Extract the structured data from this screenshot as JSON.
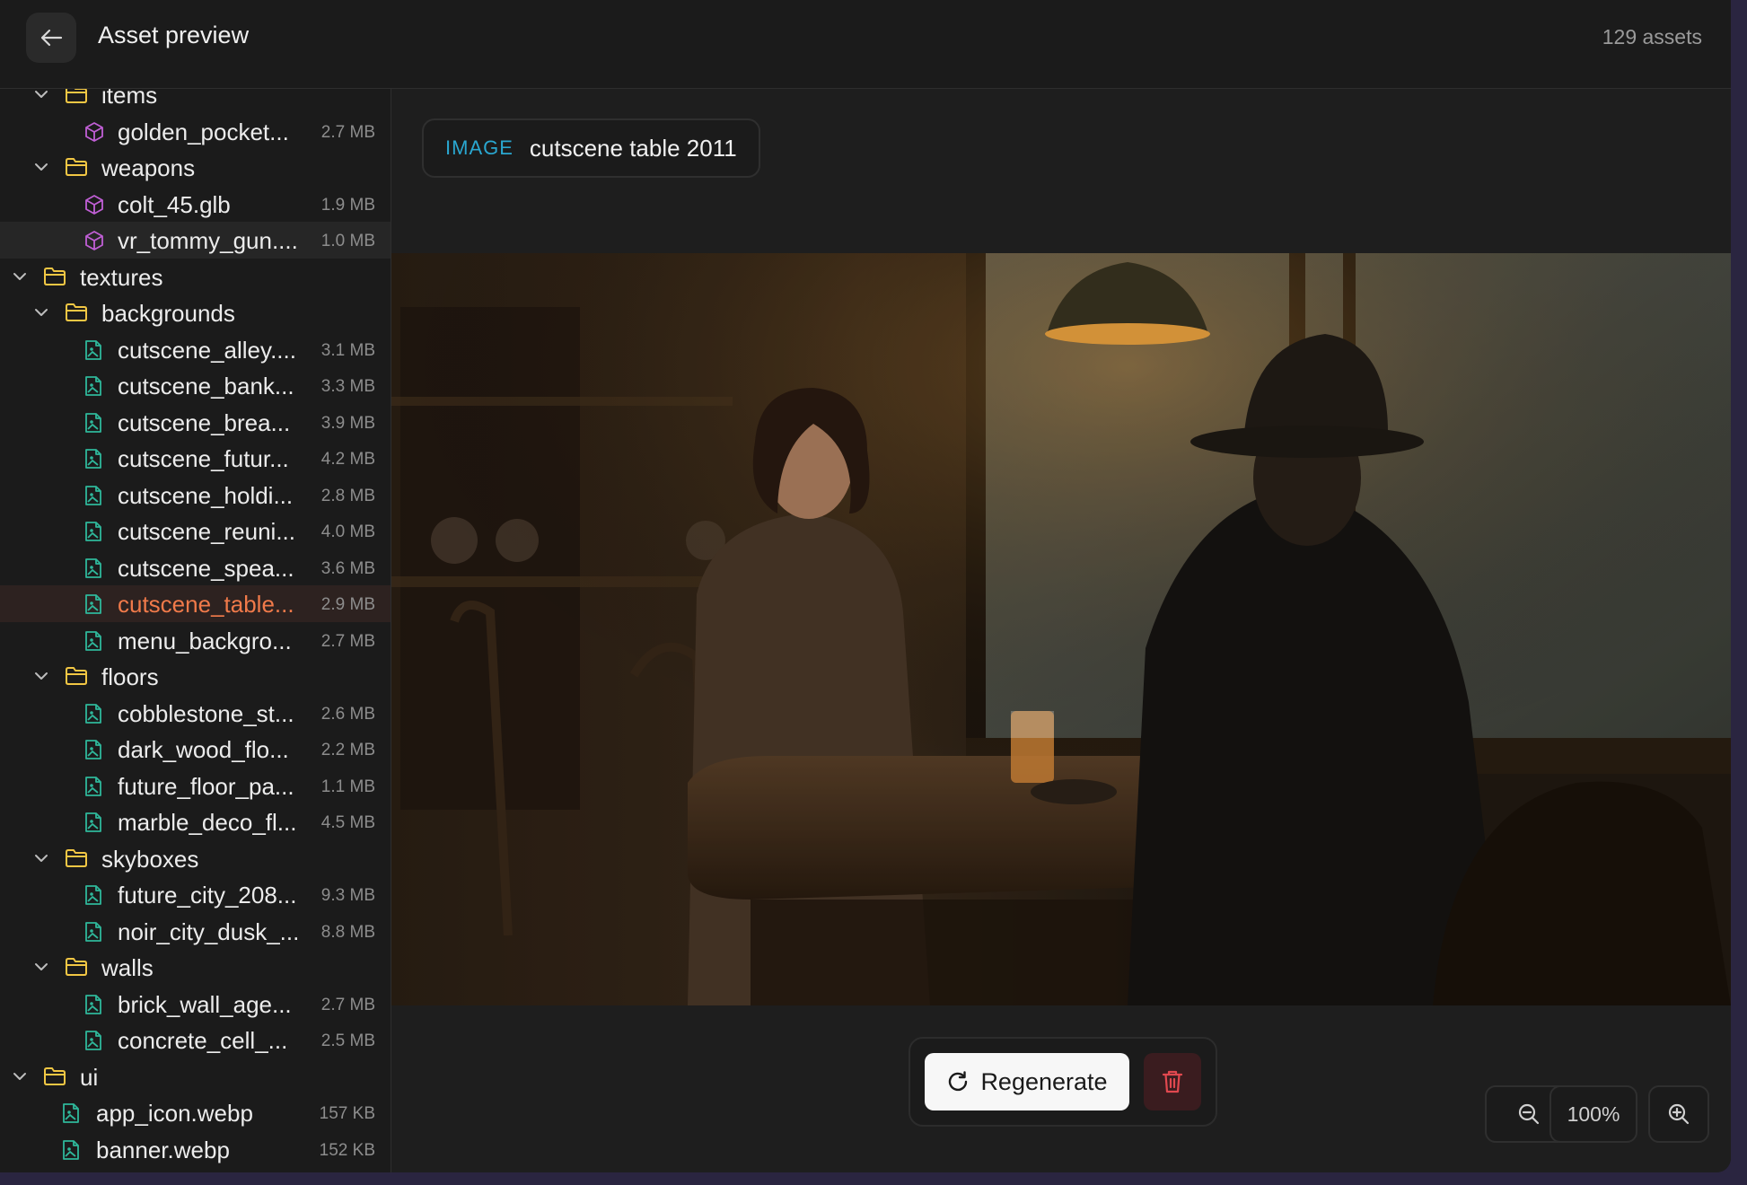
{
  "header": {
    "back_icon": "arrow-left-icon",
    "title": "Asset preview",
    "asset_count": "129 assets"
  },
  "tree": [
    {
      "kind": "folder",
      "level": 1,
      "name": "items"
    },
    {
      "kind": "model",
      "level": 2,
      "name": "golden_pocket...",
      "size": "2.7 MB"
    },
    {
      "kind": "folder",
      "level": 1,
      "name": "weapons"
    },
    {
      "kind": "model",
      "level": 2,
      "name": "colt_45.glb",
      "size": "1.9 MB"
    },
    {
      "kind": "model",
      "level": 2,
      "name": "vr_tommy_gun....",
      "size": "1.0 MB",
      "state": "hover"
    },
    {
      "kind": "folder",
      "level": 0,
      "name": "textures"
    },
    {
      "kind": "folder",
      "level": 1,
      "name": "backgrounds"
    },
    {
      "kind": "image",
      "level": 2,
      "name": "cutscene_alley....",
      "size": "3.1 MB"
    },
    {
      "kind": "image",
      "level": 2,
      "name": "cutscene_bank...",
      "size": "3.3 MB"
    },
    {
      "kind": "image",
      "level": 2,
      "name": "cutscene_brea...",
      "size": "3.9 MB"
    },
    {
      "kind": "image",
      "level": 2,
      "name": "cutscene_futur...",
      "size": "4.2 MB"
    },
    {
      "kind": "image",
      "level": 2,
      "name": "cutscene_holdi...",
      "size": "2.8 MB"
    },
    {
      "kind": "image",
      "level": 2,
      "name": "cutscene_reuni...",
      "size": "4.0 MB"
    },
    {
      "kind": "image",
      "level": 2,
      "name": "cutscene_spea...",
      "size": "3.6 MB"
    },
    {
      "kind": "image",
      "level": 2,
      "name": "cutscene_table...",
      "size": "2.9 MB",
      "state": "selected"
    },
    {
      "kind": "image",
      "level": 2,
      "name": "menu_backgro...",
      "size": "2.7 MB"
    },
    {
      "kind": "folder",
      "level": 1,
      "name": "floors"
    },
    {
      "kind": "image",
      "level": 2,
      "name": "cobblestone_st...",
      "size": "2.6 MB"
    },
    {
      "kind": "image",
      "level": 2,
      "name": "dark_wood_flo...",
      "size": "2.2 MB"
    },
    {
      "kind": "image",
      "level": 2,
      "name": "future_floor_pa...",
      "size": "1.1 MB"
    },
    {
      "kind": "image",
      "level": 2,
      "name": "marble_deco_fl...",
      "size": "4.5 MB"
    },
    {
      "kind": "folder",
      "level": 1,
      "name": "skyboxes"
    },
    {
      "kind": "image",
      "level": 2,
      "name": "future_city_208...",
      "size": "9.3 MB"
    },
    {
      "kind": "image",
      "level": 2,
      "name": "noir_city_dusk_...",
      "size": "8.8 MB"
    },
    {
      "kind": "folder",
      "level": 1,
      "name": "walls"
    },
    {
      "kind": "image",
      "level": 2,
      "name": "brick_wall_age...",
      "size": "2.7 MB"
    },
    {
      "kind": "image",
      "level": 2,
      "name": "concrete_cell_...",
      "size": "2.5 MB"
    },
    {
      "kind": "folder",
      "level": 0,
      "name": "ui"
    },
    {
      "kind": "image",
      "level": 1,
      "name": "app_icon.webp",
      "size": "157 KB"
    },
    {
      "kind": "image",
      "level": 1,
      "name": "banner.webp",
      "size": "152 KB"
    }
  ],
  "preview": {
    "type_label": "IMAGE",
    "asset_name": "cutscene table 2011"
  },
  "actions": {
    "regenerate_label": "Regenerate",
    "regenerate_icon": "refresh-icon",
    "delete_icon": "trash-icon"
  },
  "zoom": {
    "level": "100%",
    "zoom_out_icon": "zoom-out-icon",
    "zoom_in_icon": "zoom-in-icon"
  },
  "colors": {
    "folder": "#f2c744",
    "model": "#c15fd6",
    "image": "#2fb89b",
    "selected_text": "#f07a4a",
    "type_label": "#2aa7d0"
  }
}
